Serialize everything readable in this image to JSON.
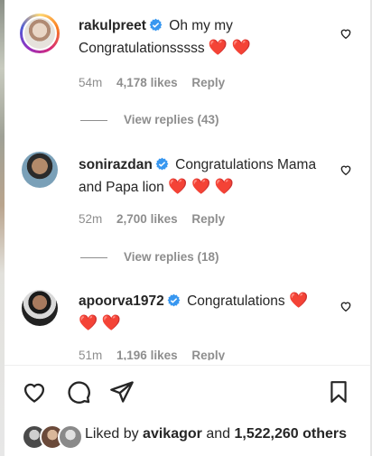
{
  "comments": [
    {
      "username": "rakulpreet",
      "text": "Oh my my Congratulationsssss",
      "hearts": "❤️ ❤️",
      "time": "54m",
      "likes": "4,178 likes",
      "reply": "Reply",
      "view_replies": "View replies (43)"
    },
    {
      "username": "sonirazdan",
      "text": "Congratulations Mama and Papa lion",
      "hearts": "❤️ ❤️ ❤️",
      "time": "52m",
      "likes": "2,700 likes",
      "reply": "Reply",
      "view_replies": "View replies (18)"
    },
    {
      "username": "apoorva1972",
      "text": "Congratulations",
      "hearts_inline": "❤️",
      "hearts_next": "❤️ ❤️",
      "time": "51m",
      "likes": "1,196 likes",
      "reply": "Reply"
    }
  ],
  "footer": {
    "liked_by_prefix": "Liked by",
    "liked_by_user": "avikagor",
    "and": "and",
    "others": "1,522,260 others"
  },
  "icons": {
    "verified": "verified-badge-icon",
    "comment_like": "heart-outline-icon",
    "like": "heart-outline-icon",
    "comment": "comment-icon",
    "share": "share-icon",
    "save": "bookmark-icon"
  },
  "colors": {
    "verified": "#3897f0",
    "heart": "#ed1c24",
    "muted": "#8e8e8e",
    "text": "#262626"
  }
}
